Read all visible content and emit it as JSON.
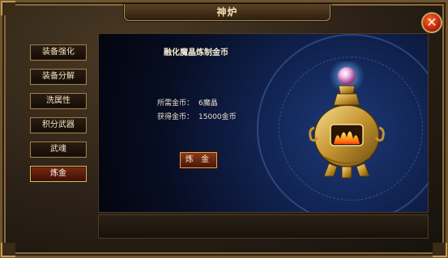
{
  "window": {
    "title": "神炉",
    "close_label": "✕"
  },
  "menu": {
    "items": [
      {
        "label": "装备强化",
        "active": false
      },
      {
        "label": "装备分解",
        "active": false
      },
      {
        "label": "洗属性",
        "active": false
      },
      {
        "label": "积分武器",
        "active": false
      },
      {
        "label": "武魂",
        "active": false
      },
      {
        "label": "炼金",
        "active": true
      }
    ]
  },
  "alchemy": {
    "title": "融化魔晶炼制金币",
    "cost_label": "所需金币：",
    "cost_value": "6魔晶",
    "gain_label": "获得金币：",
    "gain_value": "15000金币",
    "button_label": "炼 金"
  },
  "icons": {
    "close": "close-icon",
    "furnace": "golden-furnace-icon"
  },
  "colors": {
    "active_tab": "#7a2b12",
    "close_red": "#c22a10",
    "panel_blue": "#10214d",
    "gold": "#c9a35a"
  }
}
